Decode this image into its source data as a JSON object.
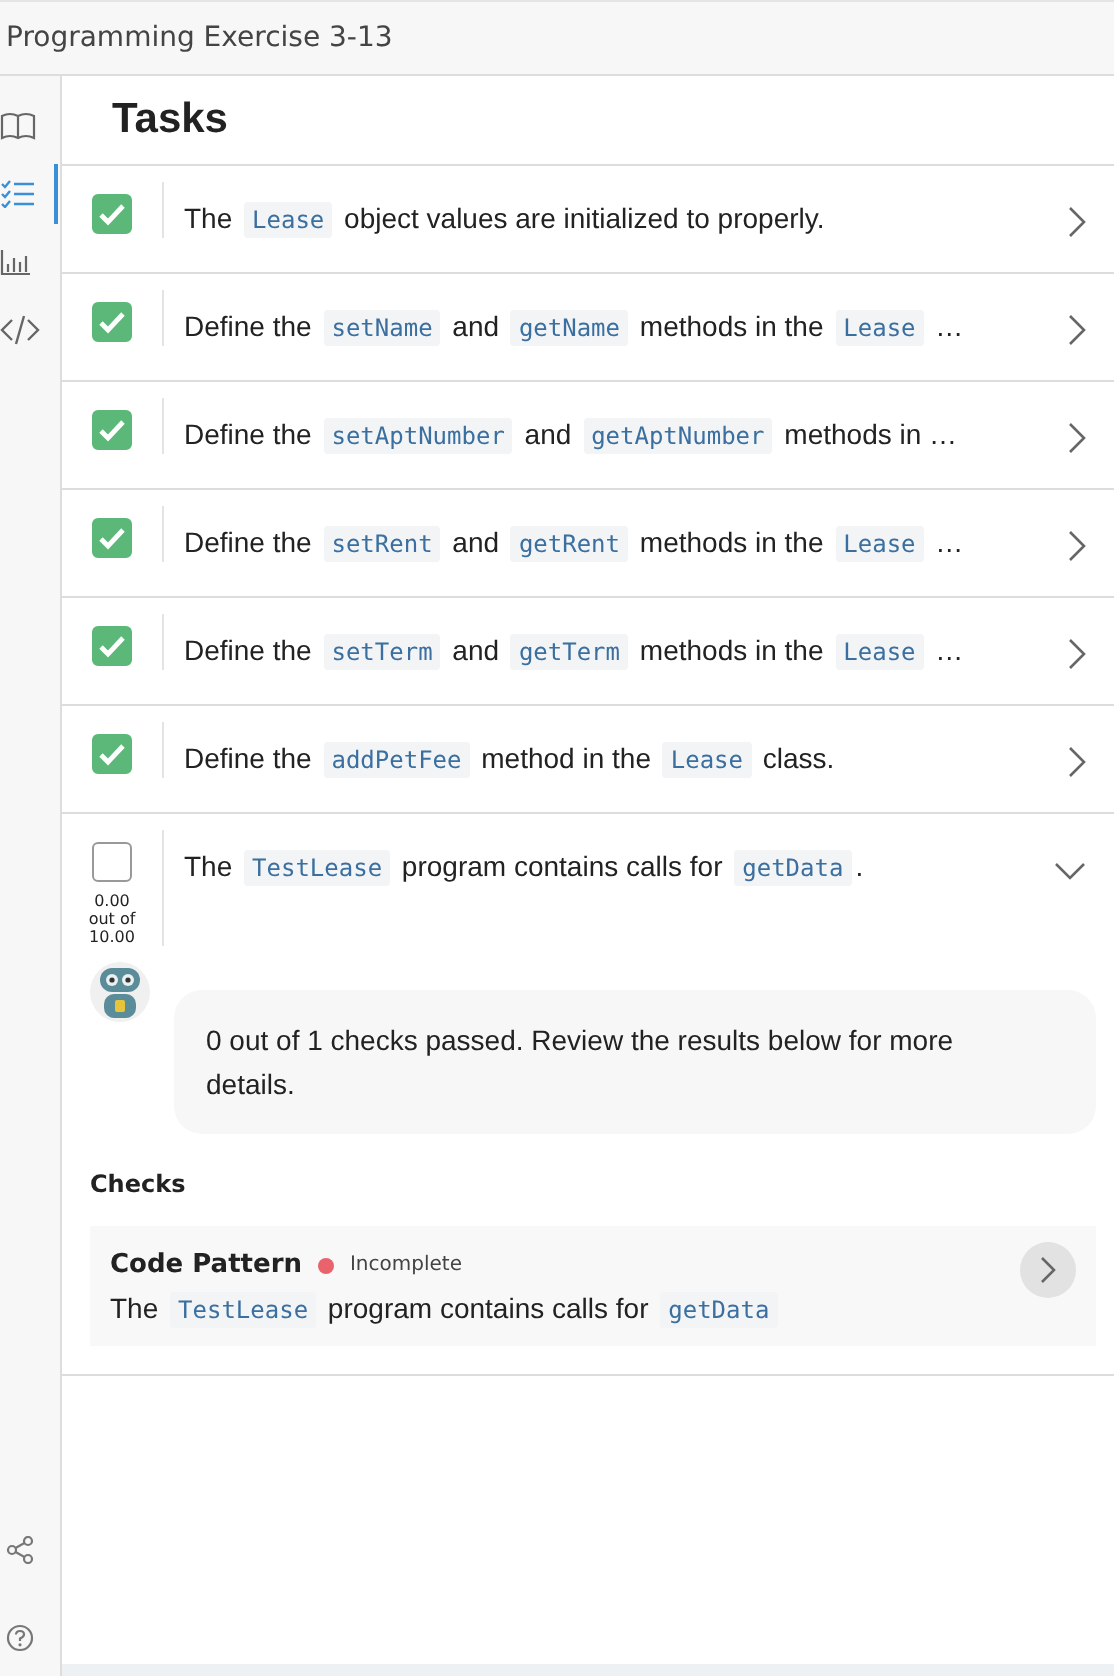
{
  "window": {
    "title": "Programming Exercise 3-13"
  },
  "sidebar": {
    "items": [
      {
        "selected": false
      },
      {
        "selected": true
      },
      {
        "selected": false
      },
      {
        "selected": false
      }
    ]
  },
  "heading": "Tasks",
  "tasks": [
    {
      "checked": true,
      "expanded": false,
      "parts": [
        {
          "kind": "text",
          "text": "The "
        },
        {
          "kind": "code",
          "text": "Lease"
        },
        {
          "kind": "text",
          "text": " object values are initialized to properly."
        }
      ]
    },
    {
      "checked": true,
      "expanded": false,
      "parts": [
        {
          "kind": "text",
          "text": "Define the "
        },
        {
          "kind": "code",
          "text": "setName"
        },
        {
          "kind": "text",
          "text": " and "
        },
        {
          "kind": "code",
          "text": "getName"
        },
        {
          "kind": "text",
          "text": " methods in the "
        },
        {
          "kind": "code",
          "text": "Lease"
        },
        {
          "kind": "text",
          "text": " …"
        }
      ]
    },
    {
      "checked": true,
      "expanded": false,
      "parts": [
        {
          "kind": "text",
          "text": "Define the "
        },
        {
          "kind": "code",
          "text": "setAptNumber"
        },
        {
          "kind": "text",
          "text": " and "
        },
        {
          "kind": "code",
          "text": "getAptNumber"
        },
        {
          "kind": "text",
          "text": " methods in …"
        }
      ]
    },
    {
      "checked": true,
      "expanded": false,
      "parts": [
        {
          "kind": "text",
          "text": "Define the "
        },
        {
          "kind": "code",
          "text": "setRent"
        },
        {
          "kind": "text",
          "text": " and "
        },
        {
          "kind": "code",
          "text": "getRent"
        },
        {
          "kind": "text",
          "text": " methods in the "
        },
        {
          "kind": "code",
          "text": "Lease"
        },
        {
          "kind": "text",
          "text": " …"
        }
      ]
    },
    {
      "checked": true,
      "expanded": false,
      "parts": [
        {
          "kind": "text",
          "text": "Define the "
        },
        {
          "kind": "code",
          "text": "setTerm"
        },
        {
          "kind": "text",
          "text": " and "
        },
        {
          "kind": "code",
          "text": "getTerm"
        },
        {
          "kind": "text",
          "text": " methods in the "
        },
        {
          "kind": "code",
          "text": "Lease"
        },
        {
          "kind": "text",
          "text": " …"
        }
      ]
    },
    {
      "checked": true,
      "expanded": false,
      "parts": [
        {
          "kind": "text",
          "text": "Define the "
        },
        {
          "kind": "code",
          "text": "addPetFee"
        },
        {
          "kind": "text",
          "text": " method in the "
        },
        {
          "kind": "code",
          "text": "Lease"
        },
        {
          "kind": "text",
          "text": " class."
        }
      ]
    },
    {
      "checked": false,
      "expanded": true,
      "score": [
        "0.00",
        "out of",
        "10.00"
      ],
      "parts": [
        {
          "kind": "text",
          "text": "The "
        },
        {
          "kind": "code",
          "text": "TestLease"
        },
        {
          "kind": "text",
          "text": " program contains calls for "
        },
        {
          "kind": "code",
          "text": "getData"
        },
        {
          "kind": "text",
          "text": "."
        }
      ],
      "feedback": "0 out of 1 checks passed. Review the results below for more details.",
      "checks_heading": "Checks",
      "checks": [
        {
          "name": "Code Pattern",
          "status": "Incomplete",
          "color": "#e8636b",
          "parts": [
            {
              "kind": "text",
              "text": "The "
            },
            {
              "kind": "code",
              "text": "TestLease"
            },
            {
              "kind": "text",
              "text": " program contains calls for "
            },
            {
              "kind": "code",
              "text": "getData"
            }
          ]
        }
      ]
    }
  ]
}
